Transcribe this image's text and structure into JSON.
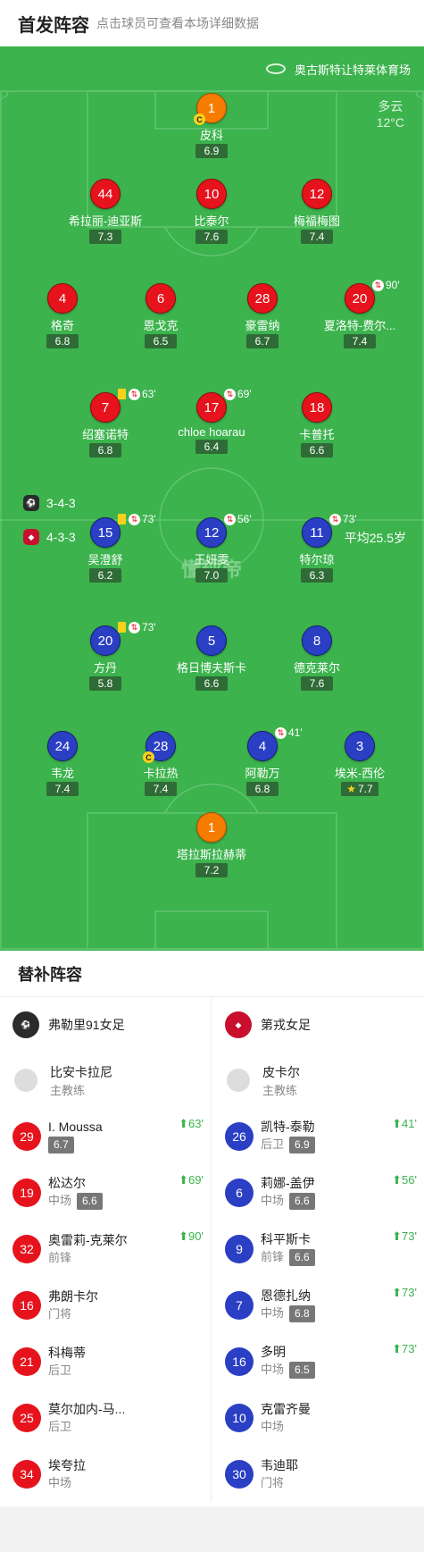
{
  "header": {
    "title": "首发阵容",
    "subtitle": "点击球员可查看本场详细数据"
  },
  "venue": "奥古斯特让特莱体育场",
  "weather": {
    "condition": "多云",
    "temp": "12°C"
  },
  "home_formation": "3-4-3",
  "away_formation": "4-3-3",
  "avg_age": "平均25.5岁",
  "logo_text": "懂球帝",
  "top_team": [
    {
      "num": "1",
      "name": "皮科",
      "rating": "6.9",
      "color": "orange",
      "captain": true
    },
    {
      "num": "44",
      "name": "希拉丽-迪亚斯",
      "rating": "7.3",
      "color": "red"
    },
    {
      "num": "10",
      "name": "比泰尔",
      "rating": "7.6",
      "color": "red"
    },
    {
      "num": "12",
      "name": "梅福梅图",
      "rating": "7.4",
      "color": "red"
    },
    {
      "num": "4",
      "name": "格奇",
      "rating": "6.8",
      "color": "red"
    },
    {
      "num": "6",
      "name": "恩戈克",
      "rating": "6.5",
      "color": "red"
    },
    {
      "num": "28",
      "name": "豪雷纳",
      "rating": "6.7",
      "color": "red"
    },
    {
      "num": "20",
      "name": "夏洛特-费尔...",
      "rating": "7.4",
      "color": "red",
      "sub": "90'"
    },
    {
      "num": "7",
      "name": "绍塞诺特",
      "rating": "6.8",
      "color": "red",
      "yellow": true,
      "sub": "63'"
    },
    {
      "num": "17",
      "name": "chloe hoarau",
      "rating": "6.4",
      "color": "red",
      "sub": "69'"
    },
    {
      "num": "18",
      "name": "卡普托",
      "rating": "6.6",
      "color": "red"
    }
  ],
  "bottom_team": [
    {
      "num": "15",
      "name": "吴澄舒",
      "rating": "6.2",
      "color": "blue",
      "yellow": true,
      "sub": "73'"
    },
    {
      "num": "12",
      "name": "王妍雯",
      "rating": "7.0",
      "color": "blue",
      "sub": "56'"
    },
    {
      "num": "11",
      "name": "特尔琼",
      "rating": "6.3",
      "color": "blue",
      "sub": "73'"
    },
    {
      "num": "20",
      "name": "方丹",
      "rating": "5.8",
      "color": "blue",
      "yellow": true,
      "sub": "73'"
    },
    {
      "num": "5",
      "name": "格日博夫斯卡",
      "rating": "6.6",
      "color": "blue"
    },
    {
      "num": "8",
      "name": "德克莱尔",
      "rating": "7.6",
      "color": "blue"
    },
    {
      "num": "24",
      "name": "韦龙",
      "rating": "7.4",
      "color": "blue"
    },
    {
      "num": "28",
      "name": "卡拉热",
      "rating": "7.4",
      "color": "blue",
      "captain": true
    },
    {
      "num": "4",
      "name": "阿勒万",
      "rating": "6.8",
      "color": "blue",
      "sub": "41'"
    },
    {
      "num": "3",
      "name": "埃米-西伦",
      "rating": "7.7",
      "color": "blue",
      "star": true
    },
    {
      "num": "1",
      "name": "塔拉斯拉赫蒂",
      "rating": "7.2",
      "color": "orange"
    }
  ],
  "bench": {
    "title": "替补阵容",
    "left": {
      "team": "弗勒里91女足",
      "coach_name": "比安卡拉尼",
      "coach_role": "主教练",
      "players": [
        {
          "num": "29",
          "name": "I. Moussa",
          "pos": "",
          "rating": "6.7",
          "sub": "63'"
        },
        {
          "num": "19",
          "name": "松达尔",
          "pos": "中场",
          "rating": "6.6",
          "sub": "69'"
        },
        {
          "num": "32",
          "name": "奥雷莉-克莱尔",
          "pos": "前锋",
          "rating": "",
          "sub": "90'"
        },
        {
          "num": "16",
          "name": "弗朗卡尔",
          "pos": "门将",
          "rating": "",
          "sub": ""
        },
        {
          "num": "21",
          "name": "科梅蒂",
          "pos": "后卫",
          "rating": "",
          "sub": ""
        },
        {
          "num": "25",
          "name": "莫尔加内-马...",
          "pos": "后卫",
          "rating": "",
          "sub": ""
        },
        {
          "num": "34",
          "name": "埃夸拉",
          "pos": "中场",
          "rating": "",
          "sub": ""
        }
      ]
    },
    "right": {
      "team": "第戎女足",
      "coach_name": "皮卡尔",
      "coach_role": "主教练",
      "players": [
        {
          "num": "26",
          "name": "凯特-泰勒",
          "pos": "后卫",
          "rating": "6.9",
          "sub": "41'"
        },
        {
          "num": "6",
          "name": "莉娜-盖伊",
          "pos": "中场",
          "rating": "6.6",
          "sub": "56'"
        },
        {
          "num": "9",
          "name": "科平斯卡",
          "pos": "前锋",
          "rating": "6.6",
          "sub": "73'"
        },
        {
          "num": "7",
          "name": "恩德扎纳",
          "pos": "中场",
          "rating": "6.8",
          "sub": "73'"
        },
        {
          "num": "16",
          "name": "多明",
          "pos": "中场",
          "rating": "6.5",
          "sub": "73'"
        },
        {
          "num": "10",
          "name": "克雷齐曼",
          "pos": "中场",
          "rating": "",
          "sub": ""
        },
        {
          "num": "30",
          "name": "韦迪耶",
          "pos": "门将",
          "rating": "",
          "sub": ""
        }
      ]
    }
  }
}
